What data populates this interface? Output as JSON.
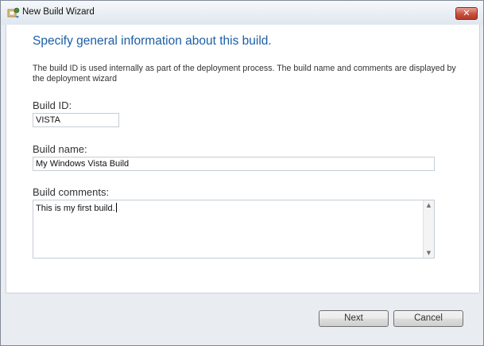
{
  "window": {
    "title": "New Build Wizard",
    "close_glyph": "✕",
    "title_icon": "wizard-icon",
    "accent_color": "#1c5ea5"
  },
  "page": {
    "heading": "Specify general information about this build.",
    "description": "The build ID is used internally as part of the deployment process. The build name and comments are displayed by the deployment wizard"
  },
  "fields": {
    "build_id": {
      "label": "Build ID:",
      "value": "VISTA"
    },
    "build_name": {
      "label": "Build name:",
      "value": "My Windows Vista Build"
    },
    "build_comments": {
      "label": "Build comments:",
      "value": "This is my first build."
    }
  },
  "scrollbar": {
    "up_arrow": "▲",
    "down_arrow": "▼"
  },
  "buttons": {
    "next": "Next",
    "cancel": "Cancel"
  }
}
